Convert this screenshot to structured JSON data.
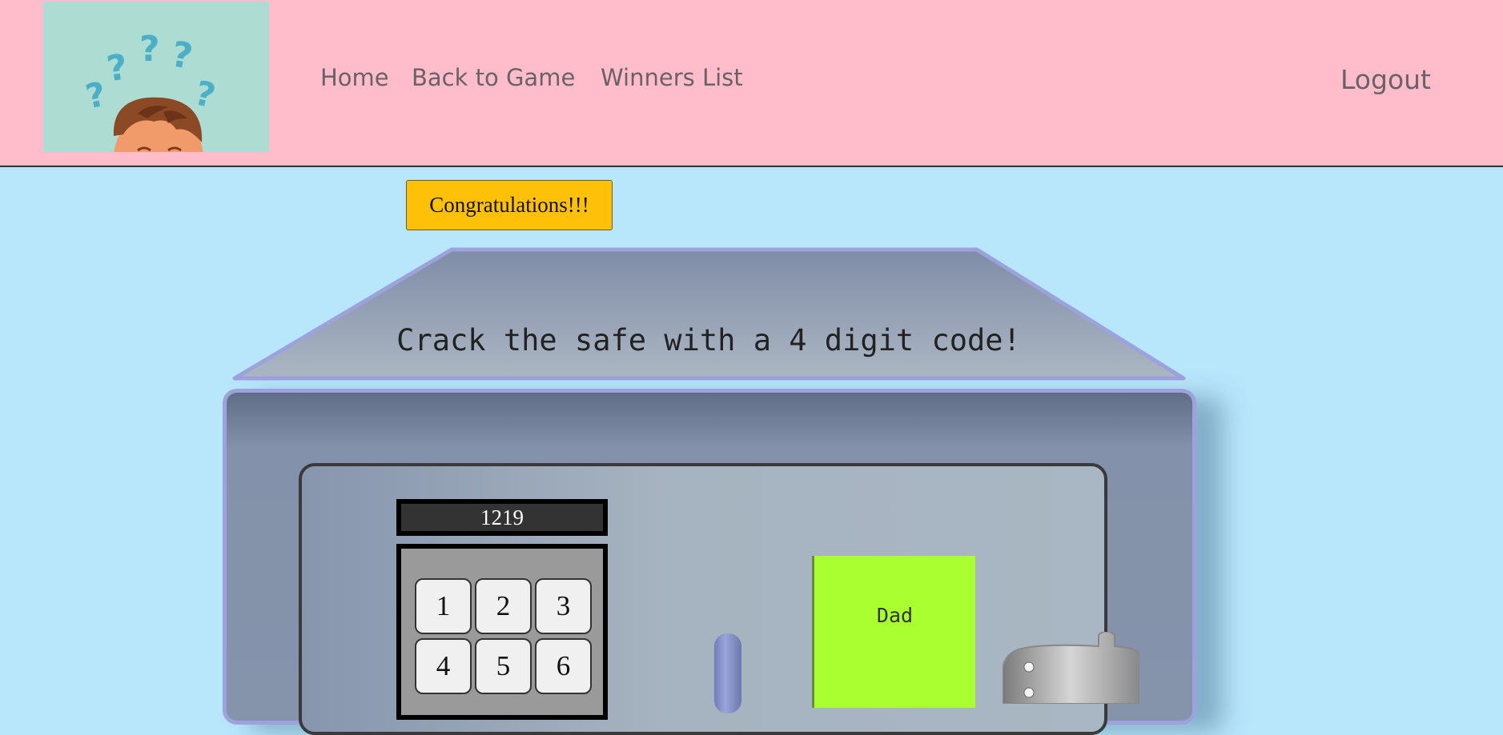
{
  "nav": {
    "home": "Home",
    "back_to_game": "Back to Game",
    "winners_list": "Winners List",
    "logout": "Logout"
  },
  "congrats_button": "Congratulations!!!",
  "safe": {
    "title": "Crack the safe with a 4 digit code!",
    "display_value": "1219",
    "keys": [
      "1",
      "2",
      "3",
      "4",
      "5",
      "6"
    ],
    "note_text": "Dad"
  },
  "colors": {
    "navbar_bg": "#ffbccb",
    "page_bg": "#b8e6fb",
    "congrats_bg": "#ffc107",
    "note_bg": "#a9ff2f"
  },
  "icons": [
    "question-marks-logo",
    "boy-head-logo"
  ]
}
